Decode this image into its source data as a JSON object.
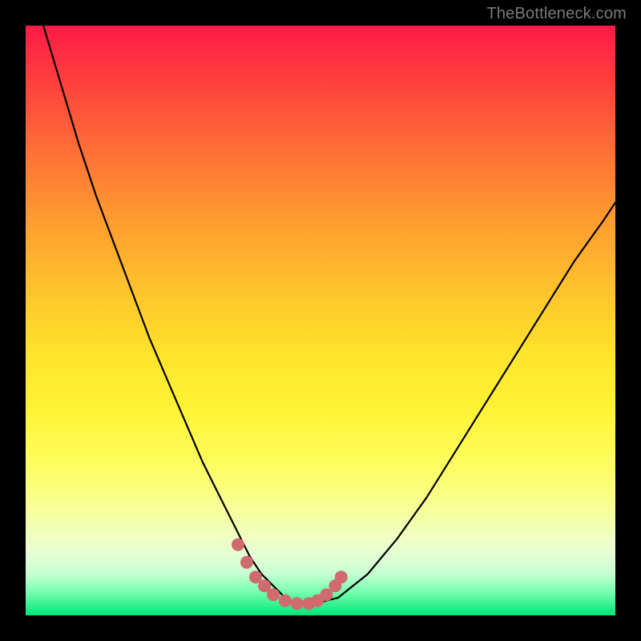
{
  "watermark": "TheBottleneck.com",
  "colors": {
    "frame": "#000000",
    "curve": "#000000",
    "bead": "#cf6a6e",
    "gradient_top": "#ff1a47",
    "gradient_bottom": "#00e676"
  },
  "chart_data": {
    "type": "line",
    "title": "",
    "xlabel": "",
    "ylabel": "",
    "xlim": [
      0,
      100
    ],
    "ylim": [
      0,
      100
    ],
    "annotations": [
      "TheBottleneck.com"
    ],
    "series": [
      {
        "name": "bottleneck-curve",
        "x": [
          3,
          6,
          9,
          12,
          15,
          18,
          21,
          24,
          27,
          30,
          32,
          34,
          36,
          38,
          40,
          42,
          44,
          46,
          49,
          53,
          58,
          63,
          68,
          73,
          78,
          83,
          88,
          93,
          98,
          100
        ],
        "y": [
          100,
          90,
          80,
          71,
          63,
          55,
          47,
          40,
          33,
          26,
          22,
          18,
          14,
          10,
          7,
          5,
          3,
          2,
          2,
          3,
          7,
          13,
          20,
          28,
          36,
          44,
          52,
          60,
          67,
          70
        ]
      },
      {
        "name": "trough-beads",
        "x": [
          36,
          37.5,
          39,
          40.5,
          42,
          44,
          46,
          48,
          49.5,
          51,
          52.5,
          53.5
        ],
        "y": [
          12,
          9,
          6.5,
          5,
          3.5,
          2.5,
          2,
          2,
          2.5,
          3.5,
          5,
          6.5
        ]
      }
    ]
  }
}
